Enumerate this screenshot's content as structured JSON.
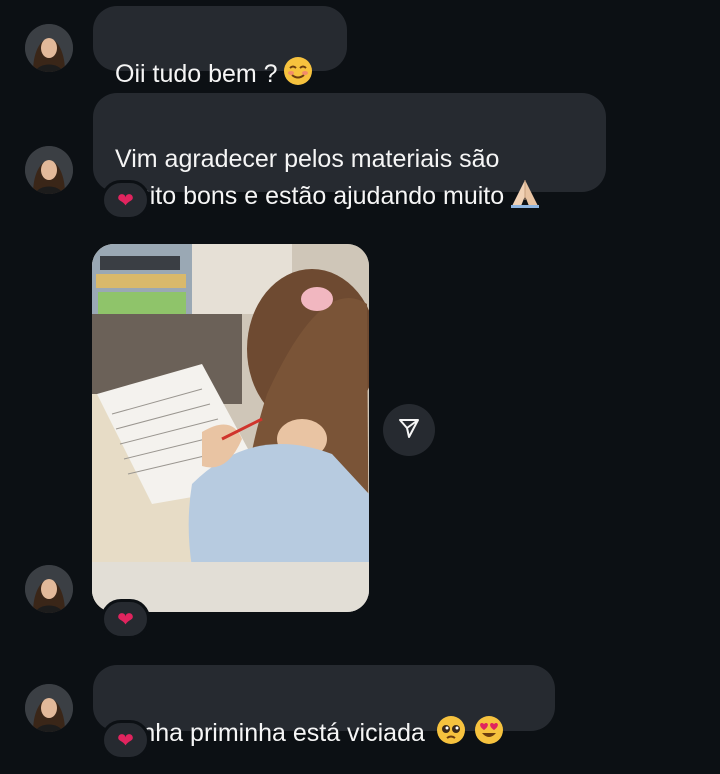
{
  "messages": [
    {
      "text": "Oii tudo bem ?",
      "emoji": "relieved-face-icon",
      "reaction": "❤"
    },
    {
      "text": "Vim agradecer pelos materiais são\nmuito bons e estão ajudando muito",
      "emoji": "folded-hands-icon",
      "reaction": "❤"
    },
    {
      "type": "photo",
      "reaction": "❤"
    },
    {
      "text": "Minha priminha está viciada",
      "emojis": [
        "pleading-face-icon",
        "heart-eyes-face-icon"
      ],
      "reaction": "❤"
    }
  ],
  "colors": {
    "background": "#0c1014",
    "bubble": "#262a30",
    "reaction_heart": "#e0245e"
  }
}
